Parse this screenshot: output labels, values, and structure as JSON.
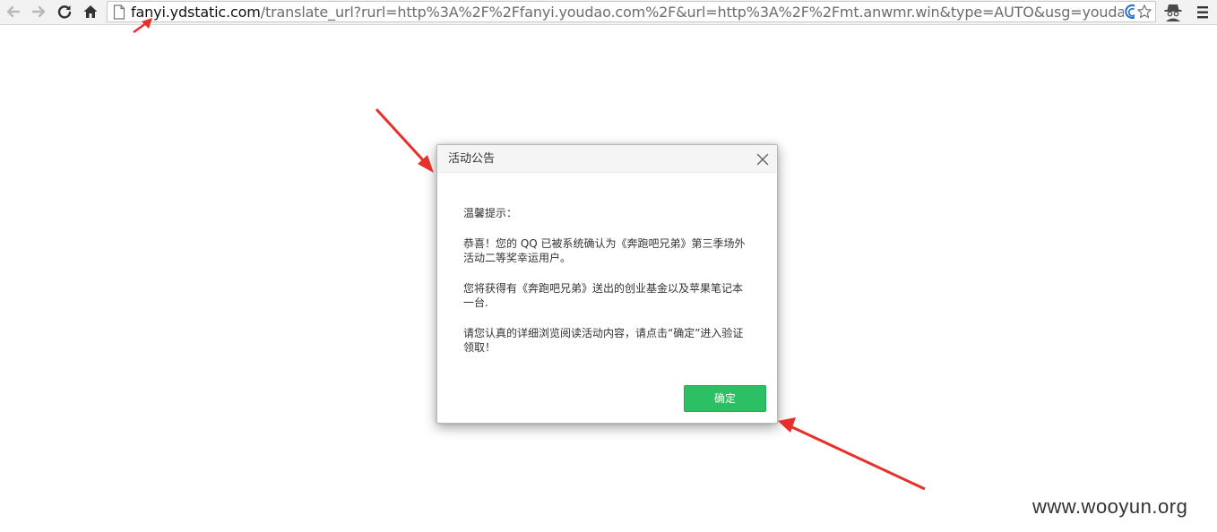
{
  "browser": {
    "url_host": "fanyi.ydstatic.com",
    "url_path": "/translate_url?rurl=http%3A%2F%2Ffanyi.youdao.com%2F&url=http%3A%2F%2Fmt.anwmr.win&type=AUTO&usg=youdaow",
    "icons": [
      "back-icon",
      "forward-icon",
      "reload-icon",
      "home-icon",
      "page-icon",
      "extension-icon",
      "star-icon",
      "incognito-icon",
      "menu-icon"
    ]
  },
  "dialog": {
    "title": "活动公告",
    "greeting": "温馨提示：",
    "paragraph1": "恭喜！您的 QQ 已被系统确认为《奔跑吧兄弟》第三季场外活动二等奖幸运用户。",
    "paragraph2": "您将获得有《奔跑吧兄弟》送出的创业基金以及苹果笔记本一台.",
    "paragraph3": "请您认真的详细浏览阅读活动内容，请点击“确定”进入验证领取！",
    "ok_label": "确定"
  },
  "watermark": "www.wooyun.org",
  "colors": {
    "accent_button": "#2cbf63",
    "arrow": "#e8302a"
  }
}
